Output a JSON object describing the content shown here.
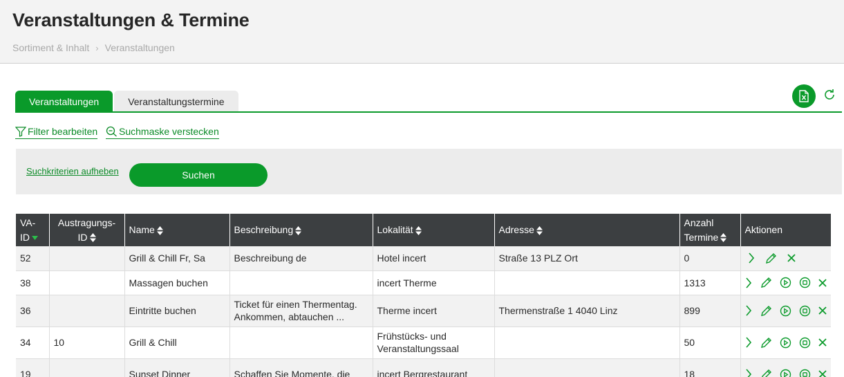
{
  "header": {
    "title": "Veranstaltungen & Termine",
    "breadcrumb": [
      "Sortiment & Inhalt",
      "Veranstaltungen"
    ]
  },
  "tabs": [
    {
      "label": "Veranstaltungen",
      "active": true
    },
    {
      "label": "Veranstaltungstermine",
      "active": false
    }
  ],
  "toolbar": {
    "filter_label": "Filter bearbeiten",
    "hide_search_label": "Suchmaske verstecken",
    "excel_icon": "excel-export-icon",
    "refresh_icon": "refresh-icon"
  },
  "search": {
    "reset_label": "Suchkriterien aufheben",
    "search_label": "Suchen"
  },
  "table": {
    "columns": [
      {
        "line1": "VA-",
        "line2": "ID"
      },
      {
        "line1": "Austragungs-",
        "line2": "ID"
      },
      {
        "line1": "Name"
      },
      {
        "line1": "Beschreibung"
      },
      {
        "line1": "Lokalität"
      },
      {
        "line1": "Adresse"
      },
      {
        "line1": "Anzahl",
        "line2": "Termine"
      },
      {
        "line1": "Aktionen"
      }
    ],
    "rows": [
      {
        "va_id": "52",
        "austragungs_id": "",
        "name": "Grill & Chill Fr, Sa",
        "beschreibung": "Beschreibung de",
        "lokalitaet": "Hotel incert",
        "adresse": "Straße 13 PLZ Ort",
        "anzahl": "0"
      },
      {
        "va_id": "38",
        "austragungs_id": "",
        "name": "Massagen buchen",
        "beschreibung": "",
        "lokalitaet": "incert Therme",
        "adresse": "",
        "anzahl": "1313"
      },
      {
        "va_id": "36",
        "austragungs_id": "",
        "name": "Eintritte buchen",
        "beschreibung": "Ticket für einen Thermentag. Ankommen, abtauchen ...",
        "lokalitaet": "Therme incert",
        "adresse": "Thermenstraße 1 4040 Linz",
        "anzahl": "899"
      },
      {
        "va_id": "34",
        "austragungs_id": "10",
        "name": "Grill & Chill",
        "beschreibung": "",
        "lokalitaet": "Frühstücks- und Veranstaltungssaal",
        "adresse": "",
        "anzahl": "50"
      },
      {
        "va_id": "19",
        "austragungs_id": "",
        "name": "Sunset Dinner",
        "beschreibung": "Schaffen Sie Momente, die",
        "lokalitaet": "incert Bergrestaurant",
        "adresse": "",
        "anzahl": "18"
      }
    ]
  },
  "colors": {
    "accent": "#0a9a2a",
    "header_bg": "#3c3f41"
  }
}
